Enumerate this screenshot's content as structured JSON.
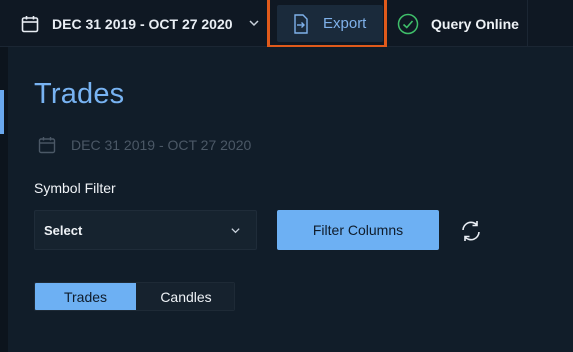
{
  "topbar": {
    "date_range": "DEC 31 2019 - OCT 27 2020",
    "export_label": "Export",
    "query_status": "Query Online"
  },
  "page": {
    "title": "Trades",
    "date_range": "DEC 31 2019 - OCT 27 2020"
  },
  "filters": {
    "symbol_filter_label": "Symbol Filter",
    "symbol_select_value": "Select",
    "filter_columns_label": "Filter Columns"
  },
  "view_toggle": {
    "tabs": [
      {
        "label": "Trades",
        "active": true
      },
      {
        "label": "Candles",
        "active": false
      }
    ]
  },
  "icons": {
    "date": "calendar-icon",
    "dropdown": "chevron-down-icon",
    "export": "file-export-icon",
    "status": "check-circle-icon",
    "refresh": "refresh-icon"
  },
  "colors": {
    "accent": "#6db0f3",
    "title": "#78b3f2",
    "highlight": "#e05a1b",
    "status_ok": "#3fbf6a",
    "background": "#0d1620"
  }
}
